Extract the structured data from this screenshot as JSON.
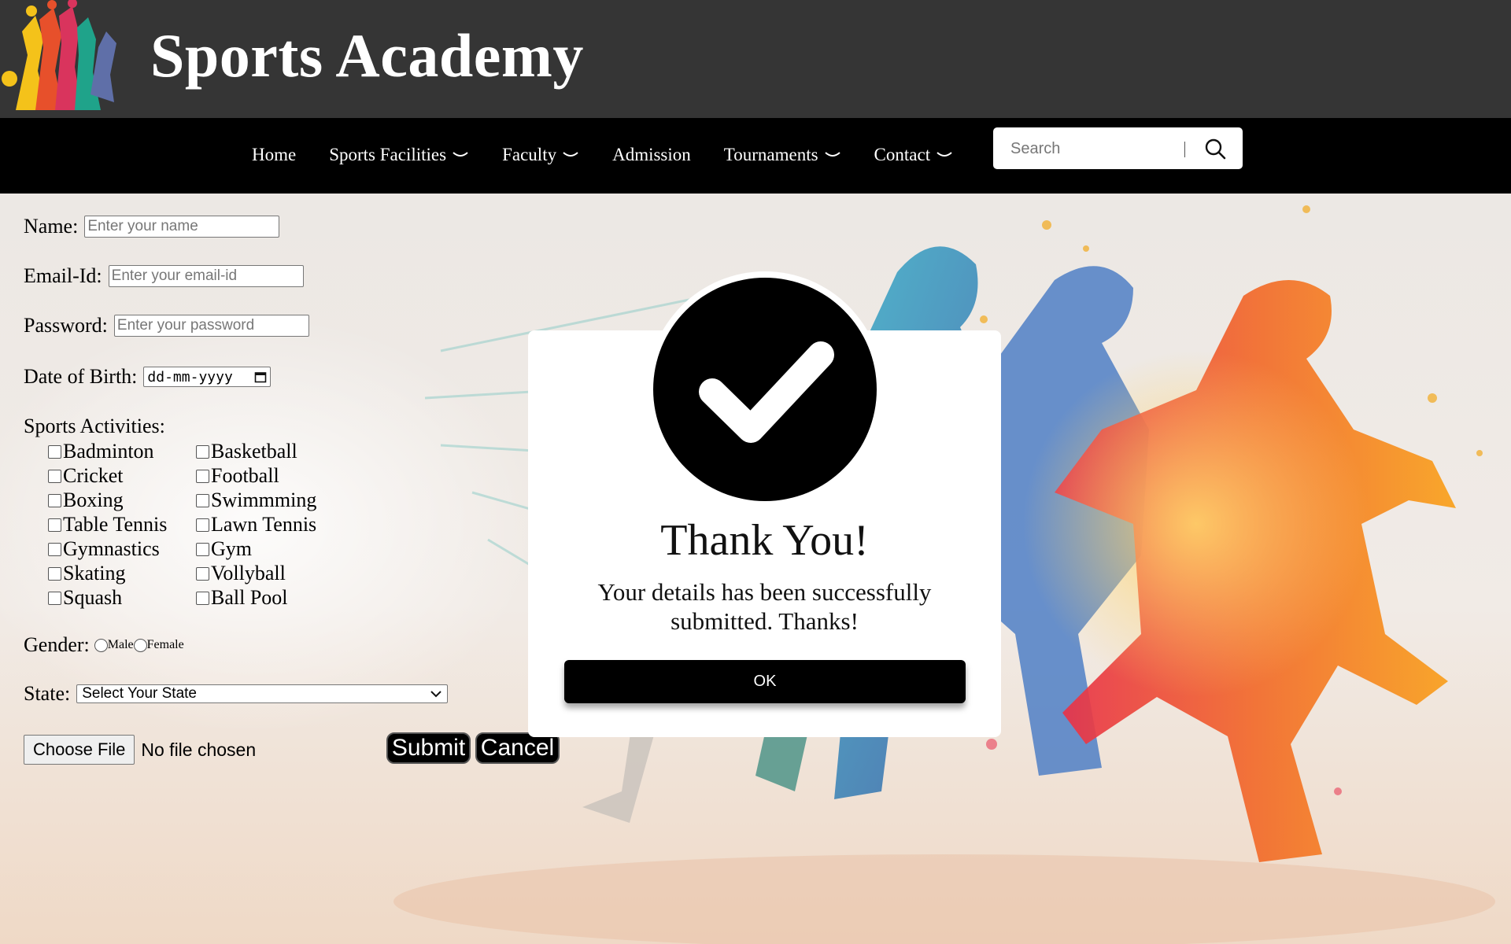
{
  "header": {
    "title": "Sports Academy"
  },
  "nav": {
    "items": [
      {
        "label": "Home",
        "dropdown": false
      },
      {
        "label": "Sports Facilities",
        "dropdown": true
      },
      {
        "label": "Faculty",
        "dropdown": true
      },
      {
        "label": "Admission",
        "dropdown": false
      },
      {
        "label": "Tournaments",
        "dropdown": true
      },
      {
        "label": "Contact",
        "dropdown": true
      }
    ],
    "search_placeholder": "Search"
  },
  "form": {
    "name_label": "Name:",
    "name_placeholder": "Enter your name",
    "email_label": "Email-Id:",
    "email_placeholder": "Enter your email-id",
    "password_label": "Password:",
    "password_placeholder": "Enter your password",
    "dob_label": "Date of Birth:",
    "dob_value": "dd-mm-yyyy",
    "sports_label": "Sports Activities:",
    "sports_col1": [
      "Badminton",
      "Cricket",
      "Boxing",
      "Table Tennis",
      "Gymnastics",
      "Skating",
      "Squash"
    ],
    "sports_col2": [
      "Basketball",
      "Football",
      "Swimmming",
      "Lawn Tennis",
      "Gym",
      "Vollyball",
      "Ball Pool"
    ],
    "gender_label": "Gender:",
    "gender_male": "Male",
    "gender_female": "Female",
    "state_label": "State:",
    "state_selected": "Select Your State",
    "file_button": "Choose File",
    "file_status": "No file chosen",
    "submit_label": "Submit",
    "cancel_label": "Cancel"
  },
  "modal": {
    "title": "Thank You!",
    "message": "Your details has been successfully submitted. Thanks!",
    "ok_label": "OK",
    "icon": "check-icon"
  },
  "colors": {
    "header_bg": "#353535",
    "nav_bg": "#000000",
    "button_bg": "#000000"
  }
}
